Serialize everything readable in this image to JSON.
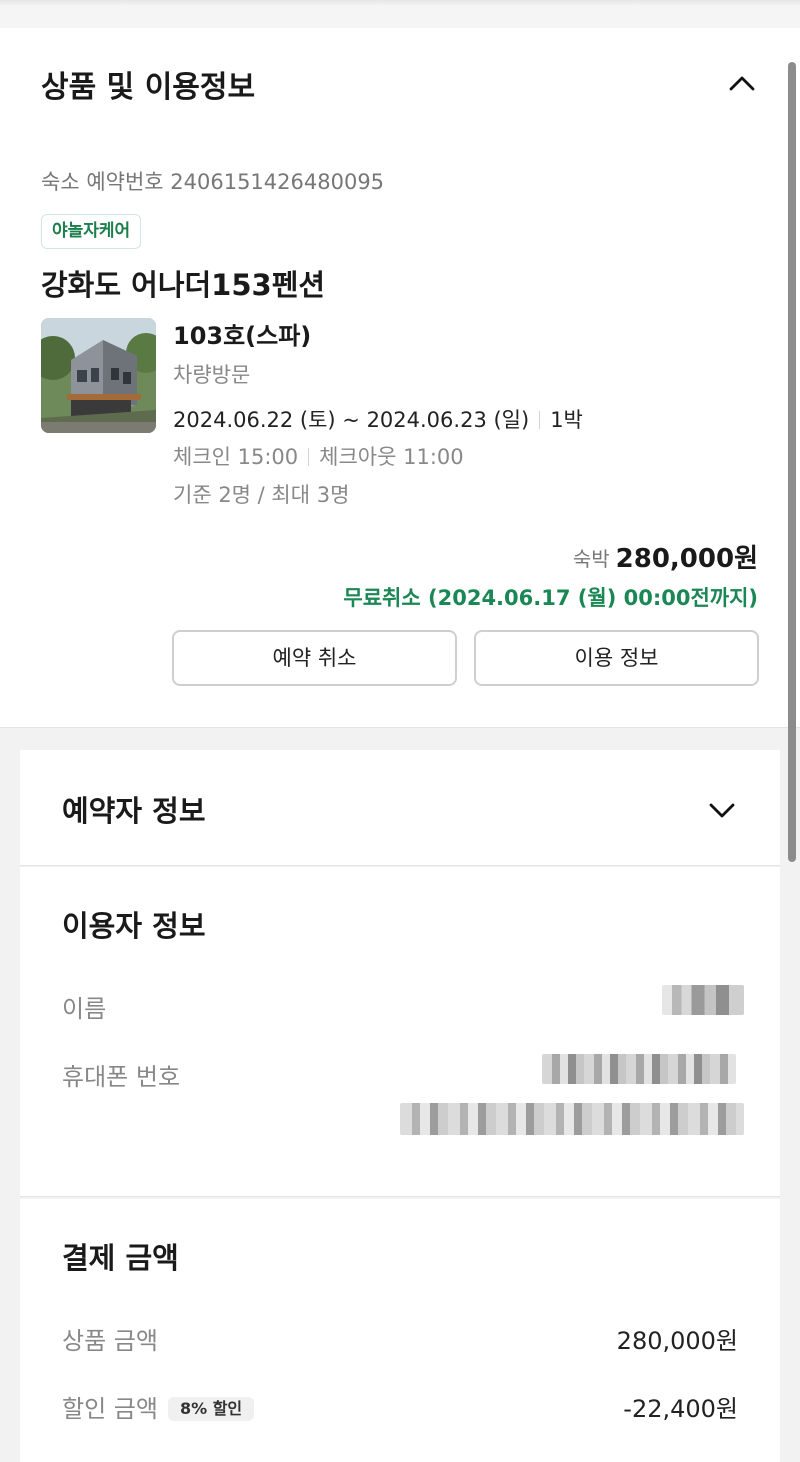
{
  "product_section": {
    "title": "상품 및 이용정보",
    "reservation_number": "숙소 예약번호 2406151426480095",
    "badge": "야놀자케어",
    "hotel_name": "강화도 어나더153펜션",
    "room_name": "103호(스파)",
    "visit_type": "차량방문",
    "dates": "2024.06.22 (토) ~ 2024.06.23 (일)",
    "nights": "1박",
    "checkin": "체크인 15:00",
    "checkout": "체크아웃 11:00",
    "capacity": "기준 2명 / 최대 3명",
    "price_label": "숙박",
    "price": "280,000원",
    "free_cancel": "무료취소 (2024.06.17 (월) 00:00전까지)",
    "cancel_button": "예약 취소",
    "info_button": "이용 정보"
  },
  "booker_section": {
    "title": "예약자 정보"
  },
  "user_section": {
    "title": "이용자 정보",
    "name_label": "이름",
    "phone_label": "휴대폰 번호"
  },
  "payment_section": {
    "title": "결제 금액",
    "product_amount_label": "상품 금액",
    "product_amount": "280,000원",
    "discount_label": "할인 금액",
    "discount_chip": "8% 할인",
    "discount_amount": "-22,400원"
  },
  "icons": {
    "collapse": "chevron-up-icon",
    "expand": "chevron-down-icon"
  }
}
